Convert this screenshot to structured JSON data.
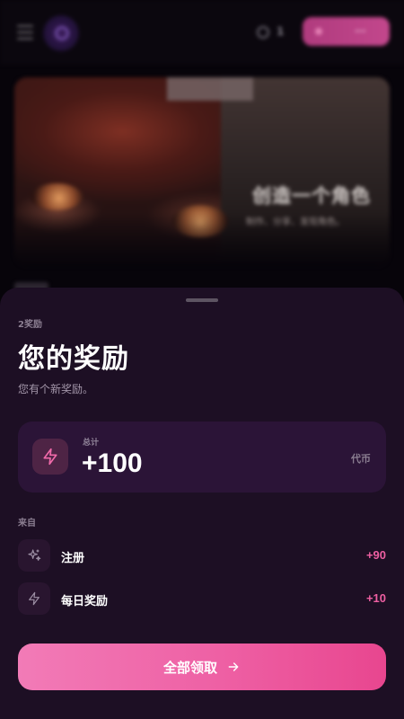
{
  "header": {
    "coin_count": "1",
    "upgrade_label": "···"
  },
  "hero": {
    "title": "创造一个角色",
    "subtitle": "制作、分享、发现角色。"
  },
  "sheet": {
    "eyebrow": "2奖励",
    "title": "您的奖励",
    "subtitle": "您有个新奖励。",
    "total": {
      "label": "总计",
      "value": "+100",
      "unit": "代币"
    },
    "from_label": "来自",
    "sources": [
      {
        "name": "注册",
        "value": "+90",
        "icon": "sparkles-icon"
      },
      {
        "name": "每日奖励",
        "value": "+10",
        "icon": "lightning-icon"
      }
    ],
    "claim_button": "全部领取"
  },
  "colors": {
    "sheet_bg": "#1d0f24",
    "card_bg": "#2b1437",
    "accent_pink": "#ee5fa2",
    "button_gradient_start": "#f27bb7",
    "button_gradient_end": "#e8468f"
  }
}
